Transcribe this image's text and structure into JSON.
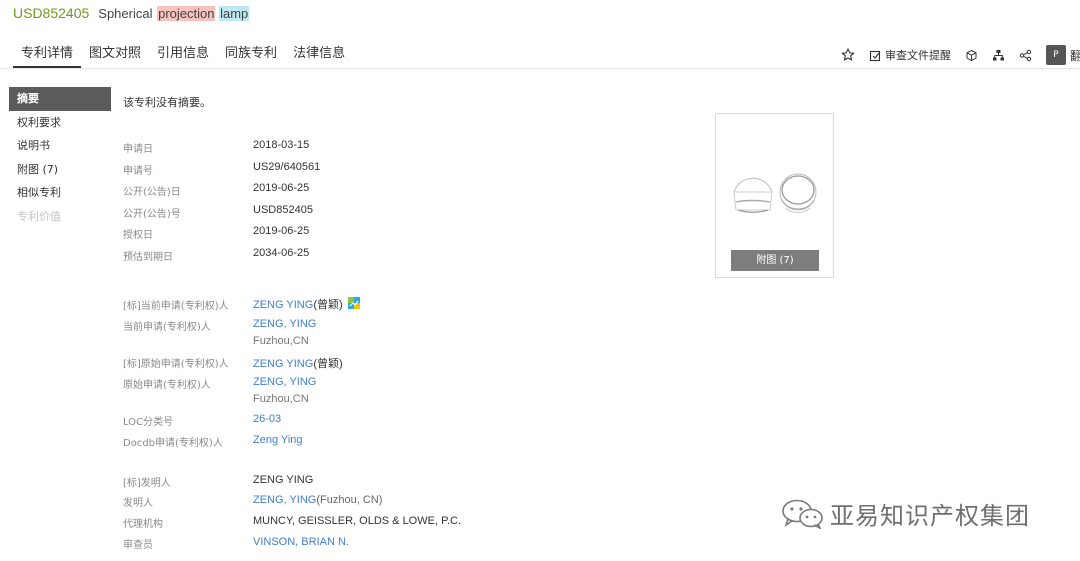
{
  "header": {
    "pub_no": "USD852405",
    "title_parts": [
      {
        "text": "Spherical",
        "hl": "none"
      },
      {
        "text": "projection",
        "hl": "red"
      },
      {
        "text": "lamp",
        "hl": "cyan"
      }
    ]
  },
  "tabs": [
    "专利详情",
    "图文对照",
    "引用信息",
    "同族专利",
    "法律信息"
  ],
  "toolbar": {
    "items": [
      {
        "icon": "star-icon",
        "label": ""
      },
      {
        "icon": "doc-alert-icon",
        "label": "审查文件提醒"
      },
      {
        "icon": "cube-icon",
        "label": ""
      },
      {
        "icon": "tree-icon",
        "label": ""
      },
      {
        "icon": "share-icon",
        "label": ""
      }
    ],
    "fold_icon_text": "P",
    "cut_text": "翻"
  },
  "sidebar": {
    "items": [
      {
        "label": "摘要",
        "state": "active"
      },
      {
        "label": "权利要求",
        "state": "normal"
      },
      {
        "label": "说明书",
        "state": "normal"
      },
      {
        "label": "附图 (7)",
        "state": "normal"
      },
      {
        "label": "相似专利",
        "state": "normal"
      },
      {
        "label": "专利价值",
        "state": "disabled"
      }
    ]
  },
  "abstract_note": "该专利没有摘要。",
  "basic_info": [
    {
      "label": "申请日",
      "value": "2018-03-15"
    },
    {
      "label": "申请号",
      "value": "US29/640561"
    },
    {
      "label": "公开(公告)日",
      "value": "2019-06-25"
    },
    {
      "label": "公开(公告)号",
      "value": "USD852405"
    },
    {
      "label": "授权日",
      "value": "2019-06-25"
    },
    {
      "label": "预估到期日",
      "value": "2034-06-25"
    }
  ],
  "parties": [
    {
      "label": "[标]当前申请(专利权)人",
      "value": "ZENG YING",
      "suffix": "(曾颖)",
      "badge": true
    },
    {
      "label": "当前申请(专利权)人",
      "value": "ZENG, YING",
      "sub": "Fuzhou,CN"
    },
    {
      "label": "[标]原始申请(专利权)人",
      "value": "ZENG YING",
      "suffix": "(曾颖)"
    },
    {
      "label": "原始申请(专利权)人",
      "value": "ZENG, YING",
      "sub": "Fuzhou,CN"
    },
    {
      "label": "LOC分类号",
      "value": "26-03"
    },
    {
      "label": "Docdb申请(专利权)人",
      "value": "Zeng Ying"
    }
  ],
  "inventors": [
    {
      "label": "[标]发明人",
      "value": "ZENG YING"
    },
    {
      "label": "发明人",
      "value": "ZENG, YING",
      "suffix": "(Fuzhou, CN)"
    },
    {
      "label": "代理机构",
      "value": "MUNCY, GEISSLER, OLDS & LOWE, P.C."
    },
    {
      "label": "审查员",
      "value": "VINSON, BRIAN N."
    }
  ],
  "figure": {
    "button": "附图 (7)"
  },
  "watermark": {
    "text": "亚易知识产权集团"
  }
}
